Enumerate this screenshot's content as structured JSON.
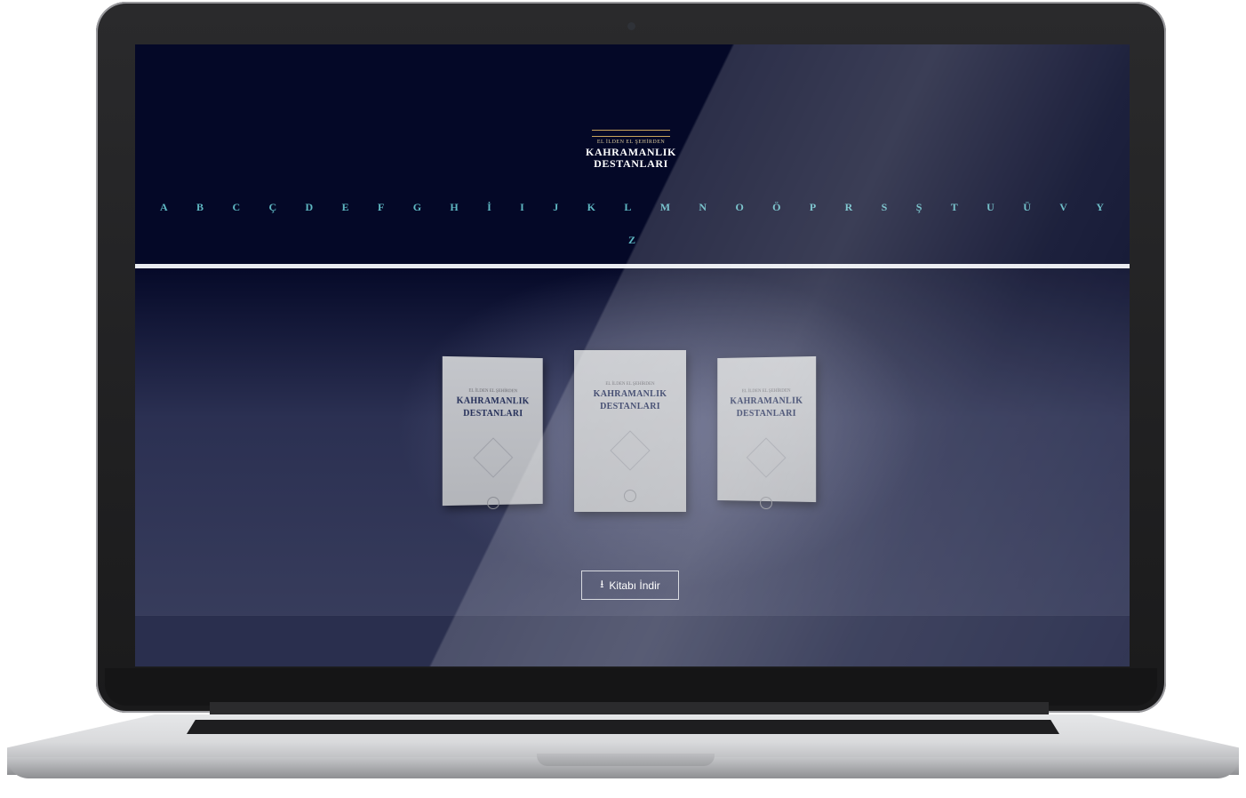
{
  "logo": {
    "small_text": "EL İLDEN EL ŞEHİRDEN",
    "title_line1": "KAHRAMANLIK",
    "title_line2": "DESTANLARI"
  },
  "alphabet": {
    "row1": [
      "A",
      "B",
      "C",
      "Ç",
      "D",
      "E",
      "F",
      "G",
      "H",
      "İ",
      "I",
      "J",
      "K",
      "L",
      "M",
      "N",
      "O",
      "Ö",
      "P",
      "R",
      "S",
      "Ş",
      "T",
      "U",
      "Ü",
      "V",
      "Y"
    ],
    "row2": [
      "Z"
    ]
  },
  "books": [
    {
      "small_text": "EL İLDEN EL ŞEHİRDEN",
      "title_line1": "KAHRAMANLIK",
      "title_line2": "DESTANLARI"
    },
    {
      "small_text": "EL İLDEN EL ŞEHİRDEN",
      "title_line1": "KAHRAMANLIK",
      "title_line2": "DESTANLARI"
    },
    {
      "small_text": "EL İLDEN EL ŞEHİRDEN",
      "title_line1": "KAHRAMANLIK",
      "title_line2": "DESTANLARI"
    }
  ],
  "download": {
    "label": "Kitabı İndir",
    "icon": "download-icon"
  },
  "colors": {
    "letter": "#5fb8c3",
    "header_bg": "#040827",
    "accent_gold": "#c9a45c"
  }
}
